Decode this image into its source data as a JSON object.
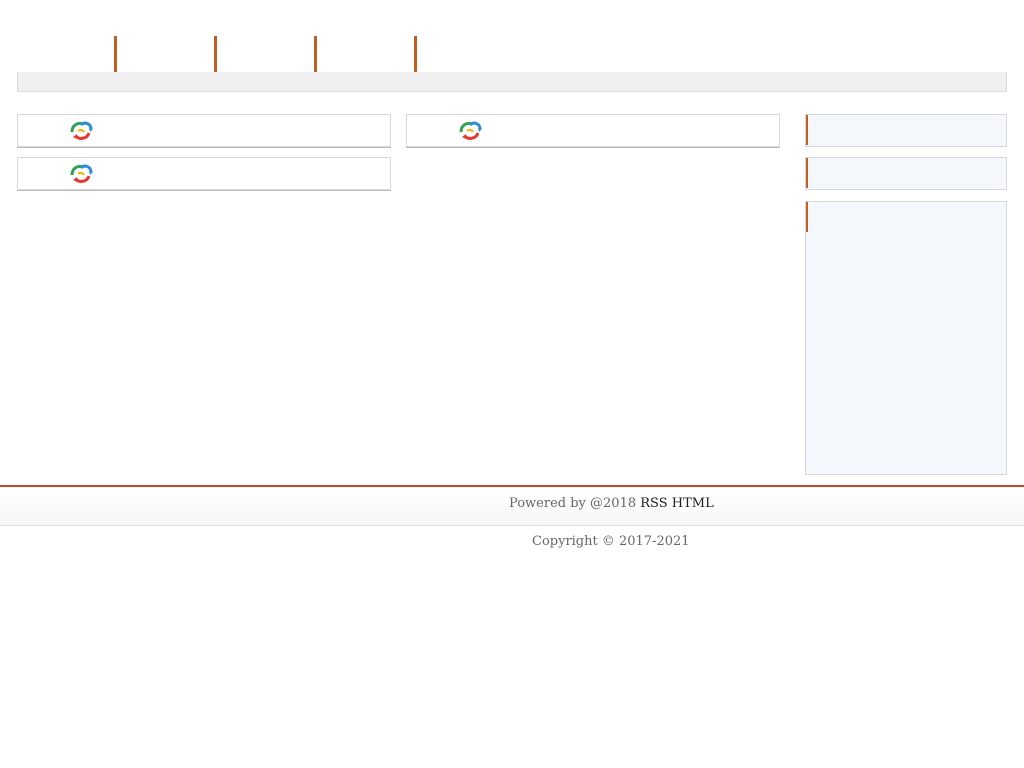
{
  "nav": {
    "items": [
      "",
      "",
      "",
      ""
    ]
  },
  "cards": [
    {
      "icon": "refresh-logo-icon",
      "title": ""
    },
    {
      "icon": "refresh-logo-icon",
      "title": ""
    },
    {
      "icon": "refresh-logo-icon",
      "title": ""
    }
  ],
  "footer": {
    "powered_prefix": "Powered by  @2018 ",
    "rss_link": "RSS",
    "html_link": "HTML",
    "copyright": "Copyright © 2017-2021"
  },
  "colors": {
    "accent": "#c0601f",
    "footer_line": "#c0472f",
    "sidebar_bg": "#f4f8fc"
  }
}
